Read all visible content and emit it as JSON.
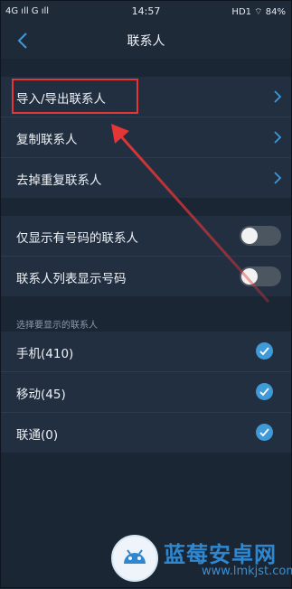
{
  "status_bar": {
    "left": "4G ıll G ıll",
    "time": "14:57",
    "right": "HD1 ⌔ 84%"
  },
  "header": {
    "title": "联系人"
  },
  "menu": [
    {
      "label": "导入/导出联系人"
    },
    {
      "label": "复制联系人"
    },
    {
      "label": "去掉重复联系人"
    }
  ],
  "toggles": [
    {
      "label": "仅显示有号码的联系人",
      "on": false
    },
    {
      "label": "联系人列表显示号码",
      "on": false
    }
  ],
  "display_section": {
    "header": "选择要显示的联系人",
    "items": [
      {
        "label": "手机(410)",
        "checked": true
      },
      {
        "label": "移动(45)",
        "checked": true
      },
      {
        "label": "联通(0)",
        "checked": true
      }
    ]
  },
  "watermark": {
    "brand": "蓝莓安卓网",
    "url": "www.lmkjst.com"
  },
  "colors": {
    "accent": "#3e9ad8",
    "annotation": "#e53636",
    "background": "#1b2635",
    "row": "#212f41"
  }
}
